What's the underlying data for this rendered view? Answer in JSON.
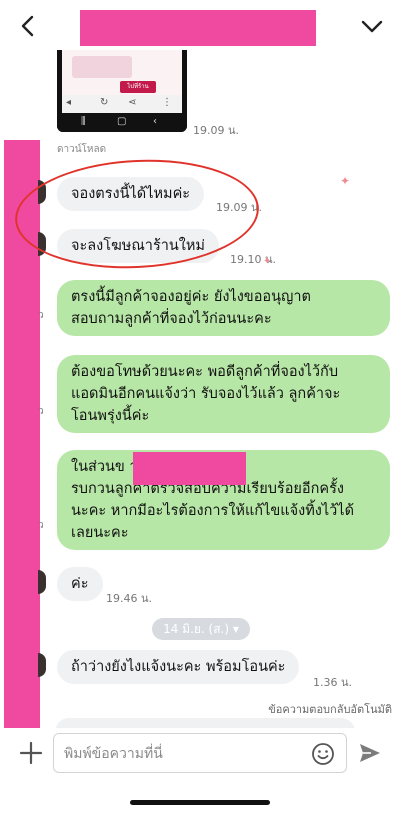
{
  "header": {
    "back_icon": "chevron-left-icon",
    "menu_icon": "chevron-down-icon"
  },
  "attachment": {
    "thumb_button": "ไปที่ร้าน",
    "time": "19.09 น."
  },
  "system": {
    "download_label": "ดาวน์โหลด"
  },
  "messages": [
    {
      "dir": "in",
      "text": "จองตรงนี้ได้ไหมค่ะ",
      "time": "19.09 น."
    },
    {
      "dir": "in",
      "text": "จะลงโฆษณาร้านใหม่",
      "time": "19.10 น."
    },
    {
      "dir": "out",
      "text": "ตรงนี้มีลูกค้าจองอยู่ค่ะ ยังไงขออนุญาต\nสอบถามลูกค้าที่จองไว้ก่อนนะคะ"
    },
    {
      "dir": "out",
      "text": "ต้องขอโทษด้วยนะคะ พอดีลูกค้าที่จองไว้กับ\nแอดมินอีกคนแจ้งว่า รับจองไว้แล้ว ลูกค้าจะ\nโอนพรุ่งนี้ค่ะ"
    },
    {
      "dir": "out",
      "text": "ในส่วนข                    านรีบแก้ไขให้แล้ว\nรบกวนลูกค้าตรวจสอบความเรียบร้อยอีกครั้ง\nนะคะ หากมีอะไรต้องการให้แก้ไขแจ้งทิ้งไว้ได้\nเลยนะคะ"
    },
    {
      "dir": "in",
      "text": "ค่ะ",
      "time": "19.46 น."
    },
    {
      "dir": "in",
      "text": "ถ้าว่างยังไงแจ้งนะคะ พร้อมโอนค่ะ",
      "time": "1.36 น."
    }
  ],
  "side_fragments": [
    "ว",
    "ว",
    "ว"
  ],
  "date_divider": "14 มิ.ย. (ส.)",
  "auto_reply_note": "ข้อความตอบกลับอัตโนมัติ",
  "composer": {
    "placeholder": "พิมพ์ข้อความที่นี่"
  },
  "colors": {
    "outgoing": "#b7e7a6",
    "incoming": "#f0f1f3",
    "redaction": "#ef4aa0",
    "annotation": "#e0342b"
  }
}
